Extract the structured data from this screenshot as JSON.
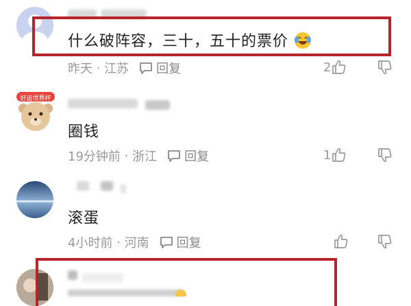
{
  "comments": [
    {
      "text": "什么破阵容，三十，五十的票价",
      "emoji": "laughing-crying",
      "time": "昨天",
      "location": "江苏",
      "reply_label": "回复",
      "likes": "2"
    },
    {
      "avatar_badge": "好运世界杯",
      "text": "圈钱",
      "time": "19分钟前",
      "location": "浙江",
      "reply_label": "回复",
      "likes": "1"
    },
    {
      "text": "滚蛋",
      "time": "4小时前",
      "location": "河南",
      "reply_label": "回复",
      "likes": ""
    }
  ],
  "highlight_color": "#b8242c"
}
